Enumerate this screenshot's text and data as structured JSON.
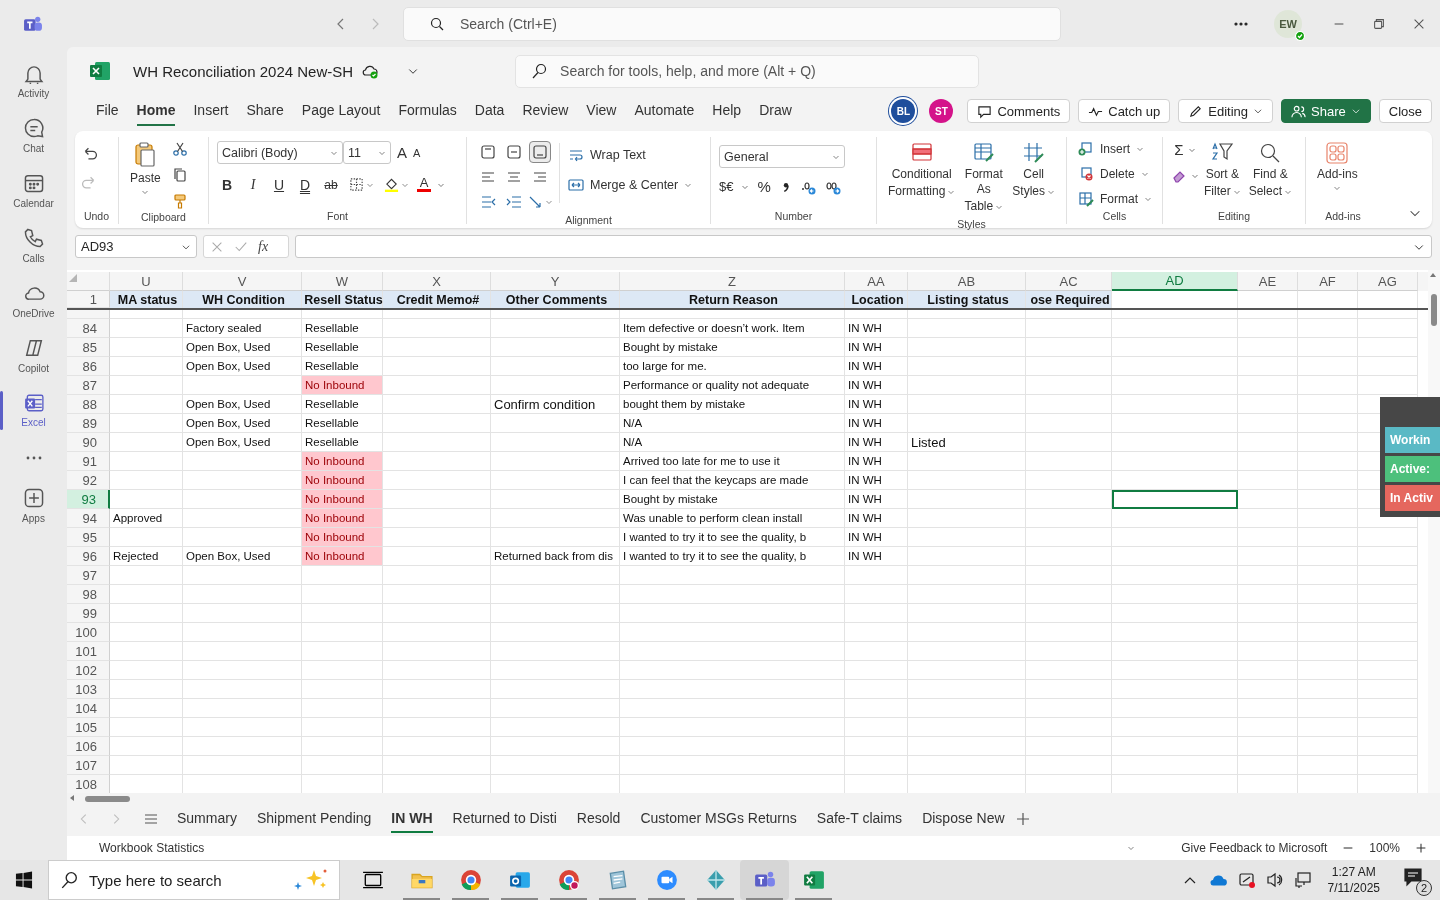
{
  "teams": {
    "search": {
      "placeholder": "Search (Ctrl+E)"
    },
    "avatar": {
      "initials": "EW"
    },
    "rail": [
      {
        "label": "Activity",
        "kind": "app",
        "selected": false
      },
      {
        "label": "Chat",
        "kind": "app",
        "selected": false
      },
      {
        "label": "Calendar",
        "kind": "app",
        "selected": false
      },
      {
        "label": "Calls",
        "kind": "app",
        "selected": false
      },
      {
        "label": "OneDrive",
        "kind": "app",
        "selected": false
      },
      {
        "label": "Copilot",
        "kind": "app",
        "selected": false
      },
      {
        "label": "Excel",
        "kind": "app",
        "selected": true
      },
      {
        "kind": "more"
      },
      {
        "label": "Apps",
        "kind": "app",
        "selected": false
      }
    ]
  },
  "workbook": {
    "title": "WH Reconciliation 2024 New-SH",
    "search": {
      "placeholder": "Search for tools, help, and more (Alt + Q)"
    }
  },
  "menu_tabs": [
    {
      "label": "File",
      "selected": false
    },
    {
      "label": "Home",
      "selected": true
    },
    {
      "label": "Insert",
      "selected": false
    },
    {
      "label": "Share",
      "selected": false
    },
    {
      "label": "Page Layout",
      "selected": false
    },
    {
      "label": "Formulas",
      "selected": false
    },
    {
      "label": "Data",
      "selected": false
    },
    {
      "label": "Review",
      "selected": false
    },
    {
      "label": "View",
      "selected": false
    },
    {
      "label": "Automate",
      "selected": false
    },
    {
      "label": "Help",
      "selected": false
    },
    {
      "label": "Draw",
      "selected": false
    }
  ],
  "collaborators": [
    {
      "initials": "BL",
      "color": "#1f4e9c"
    },
    {
      "initials": "ST",
      "color": "#d4138a"
    }
  ],
  "actions": [
    {
      "label": "Comments",
      "kind": "comments"
    },
    {
      "label": "Catch up",
      "kind": "catchup"
    },
    {
      "label": "Editing",
      "kind": "editing"
    },
    {
      "label": "Share",
      "kind": "share"
    },
    {
      "label": "Close",
      "kind": "close"
    }
  ],
  "ribbon": {
    "undo": {
      "label": "Undo"
    },
    "clipboard": {
      "paste": "Paste",
      "label": "Clipboard"
    },
    "font": {
      "family": "Calibri (Body)",
      "size": "11",
      "grow": "A",
      "shrink": "A",
      "toggles": [
        "B",
        "I",
        "U",
        "D",
        "ab"
      ],
      "color_glyph": "A",
      "label": "Font"
    },
    "alignment": {
      "wrap": "Wrap Text",
      "merge": "Merge & Center",
      "label": "Alignment"
    },
    "number": {
      "format": "General",
      "currency": "$€",
      "percent": "%",
      "label": "Number"
    },
    "styles": {
      "buttons": [
        {
          "line1": "Conditional",
          "line2": "Formatting"
        },
        {
          "line1": "Format As",
          "line2": "Table"
        },
        {
          "line1": "Cell",
          "line2": "Styles"
        }
      ],
      "label": "Styles"
    },
    "cells": {
      "buttons": [
        "Insert",
        "Delete",
        "Format"
      ],
      "label": "Cells"
    },
    "editing": {
      "sum": "Σ",
      "buttons": [
        {
          "line1": "Sort &",
          "line2": "Filter"
        },
        {
          "line1": "Find &",
          "line2": "Select"
        }
      ],
      "label": "Editing"
    },
    "addins": {
      "button": "Add-ins",
      "label": "Add-ins"
    }
  },
  "formula_bar": {
    "name_box": "AD93",
    "fx": "fx"
  },
  "sheet": {
    "columns": [
      {
        "letter": "U",
        "heading": "MA status",
        "selected": false
      },
      {
        "letter": "V",
        "heading": "WH Condition",
        "selected": false
      },
      {
        "letter": "W",
        "heading": "Resell Status",
        "selected": false
      },
      {
        "letter": "X",
        "heading": "Credit Memo#",
        "selected": false
      },
      {
        "letter": "Y",
        "heading": "Other Comments",
        "selected": false
      },
      {
        "letter": "Z",
        "heading": "Return Reason",
        "selected": false
      },
      {
        "letter": "AA",
        "heading": "Location",
        "selected": false
      },
      {
        "letter": "AB",
        "heading": "Listing status",
        "selected": false
      },
      {
        "letter": "AC",
        "heading": "ose Required",
        "selected": false
      },
      {
        "letter": "AD",
        "selected": true
      },
      {
        "letter": "AE",
        "selected": false
      },
      {
        "letter": "AF",
        "selected": false
      },
      {
        "letter": "AG",
        "selected": false
      }
    ],
    "header_row": "1",
    "rows": [
      {
        "number": "84",
        "selected": false,
        "cells": [
          null,
          {
            "text": "Factory sealed",
            "highlighted": false
          },
          {
            "text": "Resellable",
            "highlighted": false
          },
          null,
          null,
          {
            "text": "Item defective or doesn’t work. Item",
            "highlighted": false
          },
          {
            "text": "IN WH",
            "highlighted": false
          }
        ]
      },
      {
        "number": "85",
        "selected": false,
        "cells": [
          null,
          {
            "text": "Open Box, Used",
            "highlighted": false
          },
          {
            "text": "Resellable",
            "highlighted": false
          },
          null,
          null,
          {
            "text": "Bought by mistake",
            "highlighted": false
          },
          {
            "text": "IN WH",
            "highlighted": false
          }
        ]
      },
      {
        "number": "86",
        "selected": false,
        "cells": [
          null,
          {
            "text": "Open Box, Used",
            "highlighted": false
          },
          {
            "text": "Resellable",
            "highlighted": false
          },
          null,
          null,
          {
            "text": "too large for me.",
            "highlighted": false
          },
          {
            "text": "IN WH",
            "highlighted": false
          }
        ]
      },
      {
        "number": "87",
        "selected": false,
        "cells": [
          null,
          null,
          {
            "text": "No Inbound",
            "highlighted": true
          },
          null,
          null,
          {
            "text": "Performance or quality not adequate",
            "highlighted": false
          },
          {
            "text": "IN WH",
            "highlighted": false
          }
        ]
      },
      {
        "number": "88",
        "selected": false,
        "cells": [
          null,
          {
            "text": "Open Box, Used",
            "highlighted": false
          },
          {
            "text": "Resellable",
            "highlighted": false
          },
          null,
          {
            "text": "Confirm condition",
            "highlighted": false
          },
          {
            "text": "bought them by mistake",
            "highlighted": false
          },
          {
            "text": "IN WH",
            "highlighted": false
          }
        ]
      },
      {
        "number": "89",
        "selected": false,
        "cells": [
          null,
          {
            "text": "Open Box, Used",
            "highlighted": false
          },
          {
            "text": "Resellable",
            "highlighted": false
          },
          null,
          null,
          {
            "text": "N/A",
            "highlighted": false
          },
          {
            "text": "IN WH",
            "highlighted": false
          }
        ]
      },
      {
        "number": "90",
        "selected": false,
        "cells": [
          null,
          {
            "text": "Open Box, Used",
            "highlighted": false
          },
          {
            "text": "Resellable",
            "highlighted": false
          },
          null,
          null,
          {
            "text": "N/A",
            "highlighted": false
          },
          {
            "text": "IN WH",
            "highlighted": false
          },
          {
            "text": "Listed",
            "highlighted": false
          }
        ]
      },
      {
        "number": "91",
        "selected": false,
        "cells": [
          null,
          null,
          {
            "text": "No Inbound",
            "highlighted": true
          },
          null,
          null,
          {
            "text": "Arrived too late for me to use it",
            "highlighted": false
          },
          {
            "text": "IN WH",
            "highlighted": false
          }
        ]
      },
      {
        "number": "92",
        "selected": false,
        "cells": [
          null,
          null,
          {
            "text": "No Inbound",
            "highlighted": true
          },
          null,
          null,
          {
            "text": "I can feel that the keycaps are made",
            "highlighted": false
          },
          {
            "text": "IN WH",
            "highlighted": false
          }
        ]
      },
      {
        "number": "93",
        "selected": true,
        "cells": [
          null,
          null,
          {
            "text": "No Inbound",
            "highlighted": true
          },
          null,
          null,
          {
            "text": "Bought by mistake",
            "highlighted": false
          },
          {
            "text": "IN WH",
            "highlighted": false
          }
        ]
      },
      {
        "number": "94",
        "selected": false,
        "cells": [
          {
            "text": "Approved",
            "highlighted": false
          },
          null,
          {
            "text": "No Inbound",
            "highlighted": true
          },
          null,
          null,
          {
            "text": "Was unable to perform clean install",
            "highlighted": false
          },
          {
            "text": "IN WH",
            "highlighted": false
          }
        ]
      },
      {
        "number": "95",
        "selected": false,
        "cells": [
          null,
          null,
          {
            "text": "No Inbound",
            "highlighted": true
          },
          null,
          null,
          {
            "text": "I wanted to try it to see the quality, b",
            "highlighted": false
          },
          {
            "text": "IN WH",
            "highlighted": false
          }
        ]
      },
      {
        "number": "96",
        "selected": false,
        "cells": [
          {
            "text": "Rejected",
            "highlighted": false
          },
          {
            "text": "Open Box, Used",
            "highlighted": false
          },
          {
            "text": "No Inbound",
            "highlighted": true
          },
          null,
          {
            "text": "Returned back from dis",
            "highlighted": false
          },
          {
            "text": "I wanted to try it to see the quality, b",
            "highlighted": false
          },
          {
            "text": "IN WH",
            "highlighted": false
          }
        ]
      },
      {
        "number": "97",
        "selected": false
      },
      {
        "number": "98",
        "selected": false
      },
      {
        "number": "99",
        "selected": false
      },
      {
        "number": "100",
        "selected": false
      },
      {
        "number": "101",
        "selected": false
      },
      {
        "number": "102",
        "selected": false
      },
      {
        "number": "103",
        "selected": false
      },
      {
        "number": "104",
        "selected": false
      },
      {
        "number": "105",
        "selected": false
      },
      {
        "number": "106",
        "selected": false
      },
      {
        "number": "107",
        "selected": false
      },
      {
        "number": "108",
        "selected": false
      }
    ]
  },
  "float_panel": {
    "items": [
      {
        "text": "Workin",
        "color": "#5ab9c5"
      },
      {
        "text": "Active:",
        "color": "#4dc07c"
      },
      {
        "text": "In Activ",
        "color": "#e5675e"
      }
    ]
  },
  "sheet_tabs": [
    {
      "label": "Summary",
      "selected": false
    },
    {
      "label": "Shipment Pending",
      "selected": false
    },
    {
      "label": "IN WH",
      "selected": true
    },
    {
      "label": "Returned to Disti",
      "selected": false
    },
    {
      "label": "Resold",
      "selected": false
    },
    {
      "label": "Customer MSGs Returns",
      "selected": false
    },
    {
      "label": "Safe-T claims",
      "selected": false
    },
    {
      "label": "Dispose New",
      "selected": false
    }
  ],
  "status_bar": {
    "left": "Workbook Statistics",
    "feedback": "Give Feedback to Microsoft",
    "zoom": "100%"
  },
  "taskbar": {
    "search": {
      "placeholder": "Type here to search"
    },
    "time": "1:27 AM",
    "date": "7/11/2025",
    "notifications": "2"
  }
}
